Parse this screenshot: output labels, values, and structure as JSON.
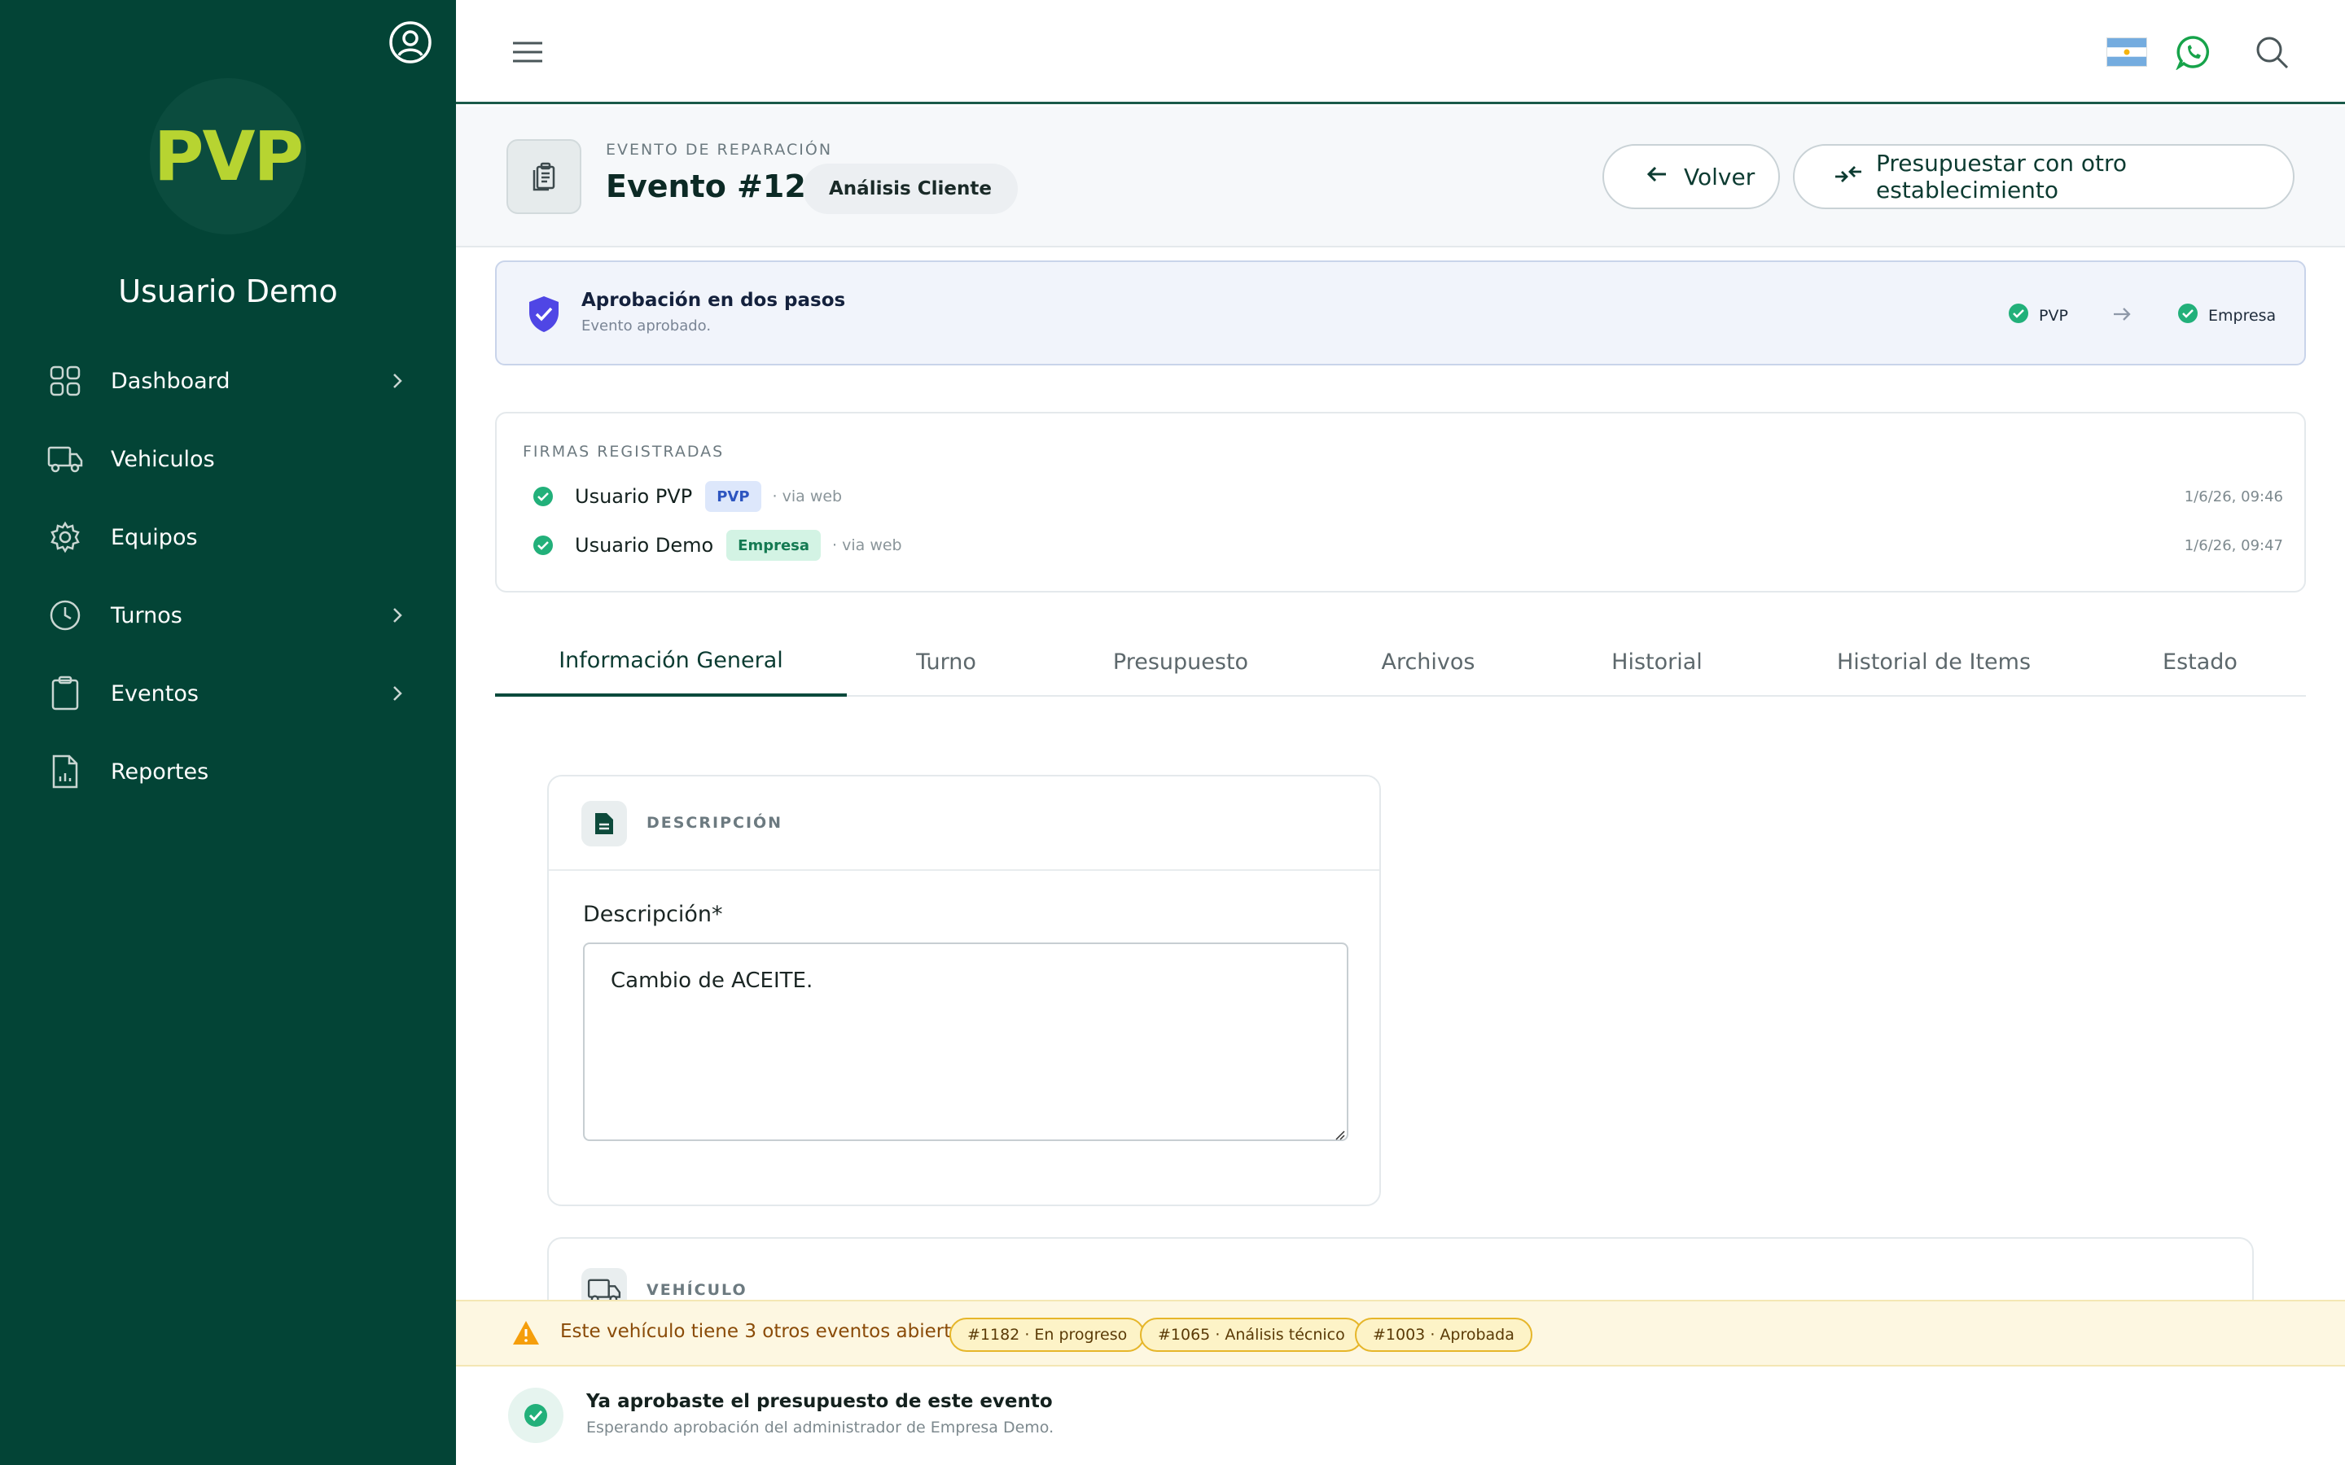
{
  "sidebar": {
    "logo_text": "PVP",
    "username": "Usuario Demo",
    "items": [
      {
        "label": "Dashboard",
        "icon": "grid-icon",
        "has_chevron": true
      },
      {
        "label": "Vehiculos",
        "icon": "truck-icon",
        "has_chevron": false
      },
      {
        "label": "Equipos",
        "icon": "gear-icon",
        "has_chevron": false
      },
      {
        "label": "Turnos",
        "icon": "clock-icon",
        "has_chevron": true
      },
      {
        "label": "Eventos",
        "icon": "clipboard-icon",
        "has_chevron": true
      },
      {
        "label": "Reportes",
        "icon": "report-icon",
        "has_chevron": false
      }
    ]
  },
  "topbar": {
    "icons": [
      "menu-icon",
      "argentina-flag-icon",
      "whatsapp-icon",
      "search-icon"
    ]
  },
  "header": {
    "eyebrow": "EVENTO DE REPARACIÓN",
    "title": "Evento #1237",
    "status": "Análisis Cliente",
    "back_label": "Volver",
    "other_label": "Presupuestar con otro establecimiento"
  },
  "approval": {
    "title": "Aprobación en dos pasos",
    "subtitle": "Evento aprobado.",
    "step1": "PVP",
    "step2": "Empresa"
  },
  "signatures": {
    "title": "FIRMAS REGISTRADAS",
    "rows": [
      {
        "name": "Usuario PVP",
        "badge": "PVP",
        "via": "· via web",
        "date": "1/6/26, 09:46"
      },
      {
        "name": "Usuario Demo",
        "badge": "Empresa",
        "via": "· via web",
        "date": "1/6/26, 09:47"
      }
    ]
  },
  "tabs": [
    "Información General",
    "Turno",
    "Presupuesto",
    "Archivos",
    "Historial",
    "Historial de Items",
    "Estado"
  ],
  "description": {
    "section_title": "DESCRIPCIÓN",
    "field_label": "Descripción*",
    "value": "Cambio de ACEITE."
  },
  "vehicle": {
    "section_title": "VEHÍCULO"
  },
  "warning": {
    "text": "Este vehículo tiene 3 otros eventos abiertos:",
    "chips": [
      "#1182 · En progreso",
      "#1065 · Análisis técnico",
      "#1003 · Aprobada"
    ]
  },
  "bottom": {
    "title": "Ya aprobaste el presupuesto de este evento",
    "subtitle": "Esperando aprobación del administrador de Empresa Demo."
  },
  "colors": {
    "sidebar_bg": "#034436",
    "logo_accent": "#b7d431",
    "success": "#22b07a",
    "shield": "#4f46e5",
    "warning": "#f59e0b"
  }
}
